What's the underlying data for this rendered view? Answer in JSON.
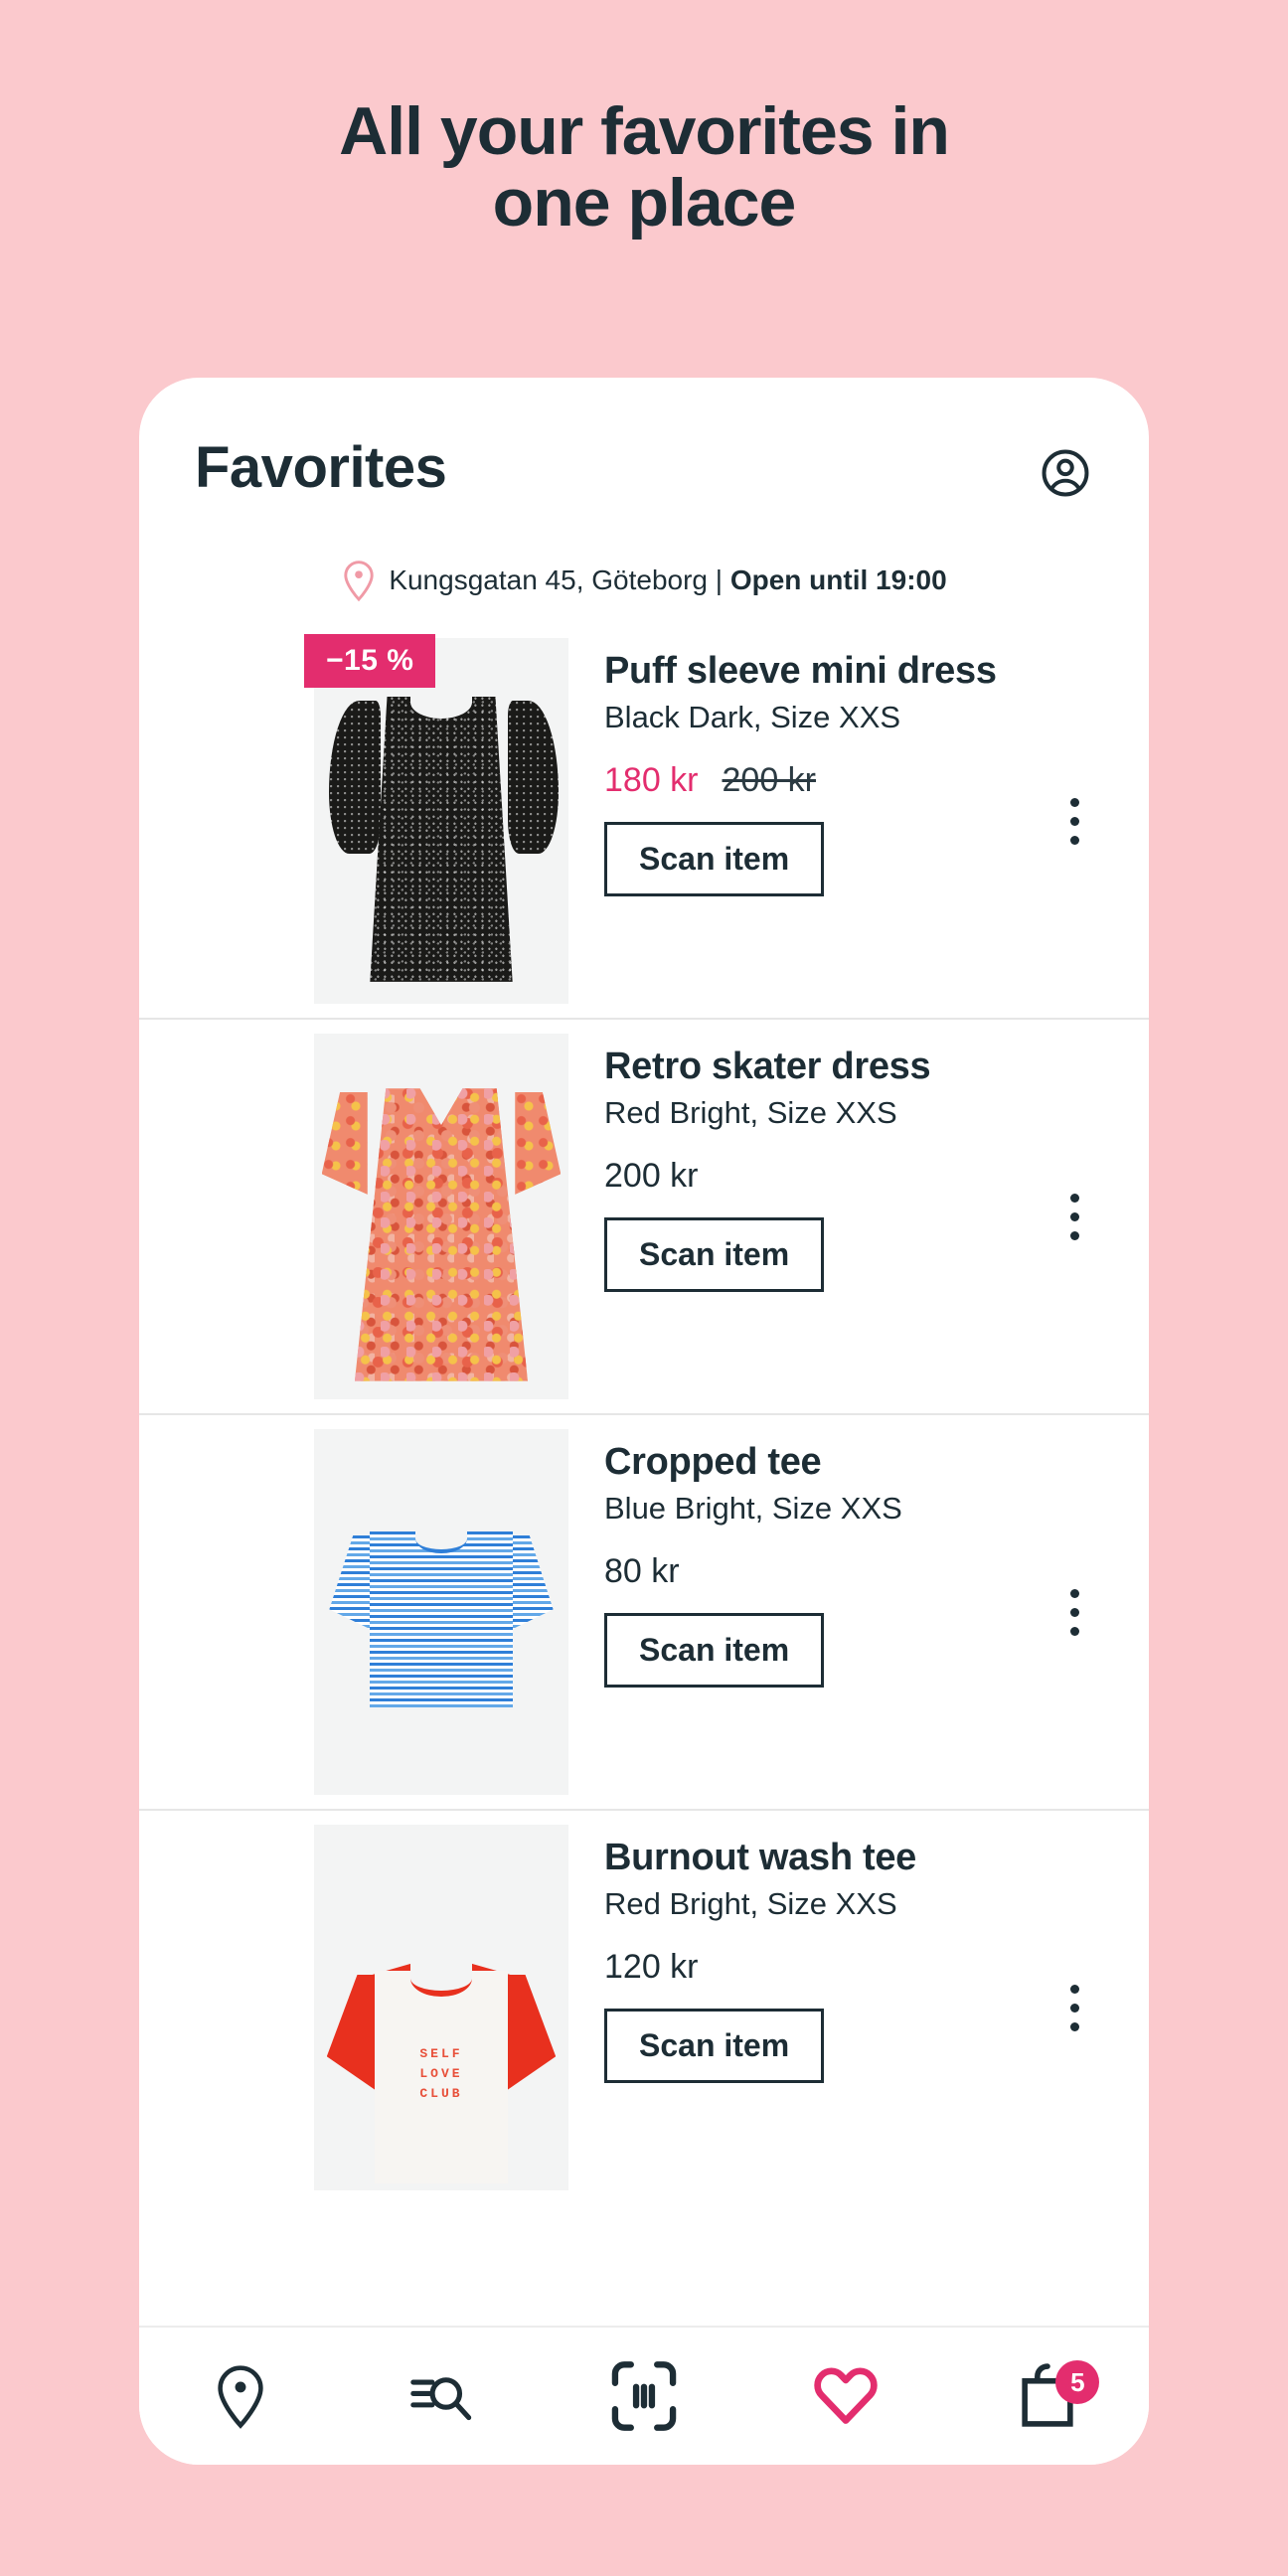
{
  "hero": {
    "headline_line1": "All your favorites in",
    "headline_line2": "one place",
    "background_color": "#FBC9CD"
  },
  "app": {
    "title": "Favorites",
    "accent_color": "#E32D6E",
    "text_color": "#1D2D35",
    "account_icon": "account-circle-icon"
  },
  "store": {
    "pin_icon": "location-pin-icon",
    "address": "Kungsgatan 45, Göteborg",
    "separator": "|",
    "hours": "Open until 19:00"
  },
  "products": [
    {
      "name": "Puff sleeve mini dress",
      "variant": "Black Dark, Size XXS",
      "price": "180 kr",
      "price_original": "200 kr",
      "on_sale": true,
      "badge": "−15 %",
      "scan_label": "Scan item",
      "menu_icon": "more-vertical-icon"
    },
    {
      "name": "Retro skater dress",
      "variant": "Red Bright, Size XXS",
      "price": "200 kr",
      "price_original": "",
      "on_sale": false,
      "badge": "",
      "scan_label": "Scan item",
      "menu_icon": "more-vertical-icon"
    },
    {
      "name": "Cropped tee",
      "variant": "Blue Bright, Size XXS",
      "price": "80 kr",
      "price_original": "",
      "on_sale": false,
      "badge": "",
      "scan_label": "Scan item",
      "menu_icon": "more-vertical-icon"
    },
    {
      "name": "Burnout wash tee",
      "variant": "Red Bright, Size XXS",
      "price": "120 kr",
      "price_original": "",
      "on_sale": false,
      "badge": "",
      "scan_label": "Scan item",
      "menu_icon": "more-vertical-icon",
      "print_line1": "SELF",
      "print_line2": "LOVE",
      "print_line3": "CLUB"
    }
  ],
  "bottom_nav": [
    {
      "icon": "location-pin-icon",
      "active": false
    },
    {
      "icon": "search-icon",
      "active": false
    },
    {
      "icon": "barcode-scan-icon",
      "active": false
    },
    {
      "icon": "heart-icon",
      "active": true
    },
    {
      "icon": "shopping-bag-icon",
      "active": false,
      "badge": "5"
    }
  ]
}
